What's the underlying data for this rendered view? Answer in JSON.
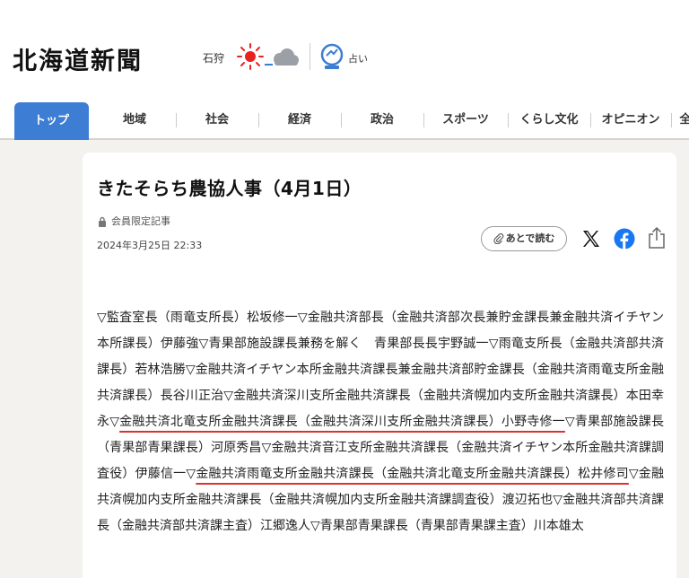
{
  "header": {
    "logo": "北海道新聞",
    "region": "石狩",
    "weather_icons": [
      "sun-icon",
      "cloud-icon"
    ],
    "fortune_label": "占い"
  },
  "nav": {
    "active": "トップ",
    "items": [
      "地域",
      "社会",
      "経済",
      "政治",
      "スポーツ",
      "くらし文化",
      "オピニオン",
      "全"
    ]
  },
  "article": {
    "title": "きたそらち農協人事（4月1日）",
    "member_label": "会員限定記事",
    "date": "2024年3月25日 22:33",
    "read_later": "あとで読む",
    "body_parts": [
      "▽監査室長（雨竜支所長）松坂修一▽金融共済部長（金融共済部次長兼貯金課長兼金融共済イチヤン本所課長）伊藤強▽青果部施設課長兼務を解く　青果部長長宇野誠一▽雨竜支所長（金融共済部共済課長）若林浩勝▽金融共済イチヤン本所金融共済課長兼金融共済部貯金課長（金融共済雨竜支所金融共済課長）長谷川正治▽金融共済深川支所金融共済課長（金融共済幌加内支所金融共済課長）本田幸永▽",
      "金融共済北竜支所金融共済課長（金融共済深川支所金融共済課長）小野寺修一",
      "▽青果部施設課長（青果部青果課長）河原秀昌▽金融共済音江支所金融共済課長（金融共済イチヤン本所金融共済課調査役）伊藤信一▽",
      "金融共済雨竜支所金融共済課長（金融共済北竜支所金融共済課長）松井修司",
      "▽金融共済幌加内支所金融共済課長（金融共済幌加内支所金融共済課調査役）渡辺拓也▽金融共済部共済課長（金融共済部共済課主査）江郷逸人▽青果部青果課長（青果部青果課主査）川本雄太"
    ]
  },
  "colors": {
    "accent": "#3d7dd4",
    "underline": "#d9342b",
    "facebook": "#1877f2"
  }
}
